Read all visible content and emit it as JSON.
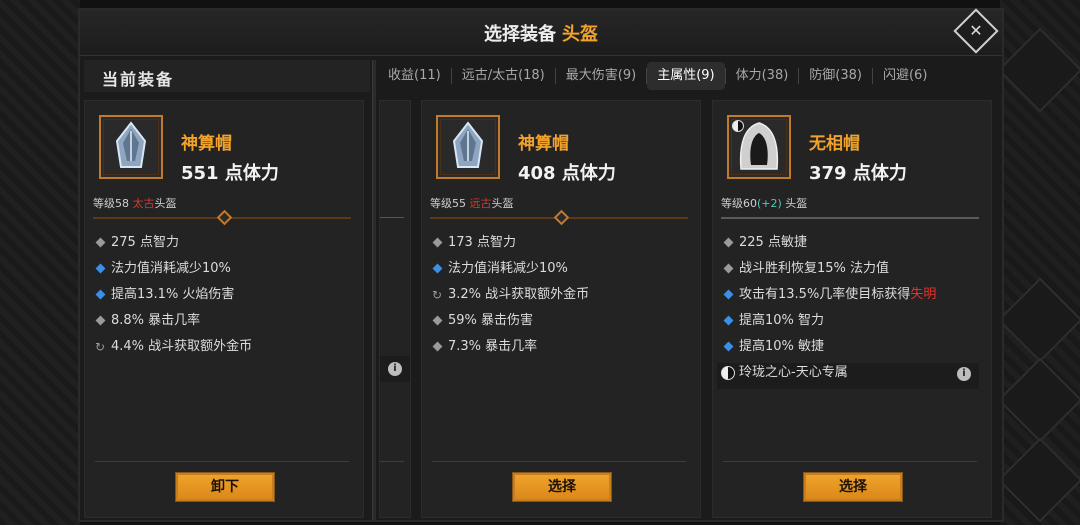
{
  "header": {
    "title_prefix": "选择装备",
    "title_accent": "头盔",
    "close_label": "✕"
  },
  "current_section": {
    "label": "当前装备"
  },
  "tabs": [
    {
      "label": "收益(11)",
      "active": false
    },
    {
      "label": "远古/太古(18)",
      "active": false
    },
    {
      "label": "最大伤害(9)",
      "active": false
    },
    {
      "label": "主属性(9)",
      "active": true
    },
    {
      "label": "体力(38)",
      "active": false
    },
    {
      "label": "防御(38)",
      "active": false
    },
    {
      "label": "闪避(6)",
      "active": false
    }
  ],
  "cards": [
    {
      "name": "神算帽",
      "stat": "551 点体力",
      "level_prefix": "等级58 ",
      "level_tag": "太古",
      "level_suffix": "头盔",
      "attributes": [
        {
          "text": "275 点智力",
          "mark": "gray"
        },
        {
          "text": "法力值消耗减少10%",
          "mark": "blue"
        },
        {
          "text": "提高13.1% 火焰伤害",
          "mark": "blue"
        },
        {
          "text": "8.8% 暴击几率",
          "mark": "gray"
        },
        {
          "text": "4.4% 战斗获取额外金币",
          "mark": "cycle"
        }
      ],
      "button": "卸下"
    },
    {
      "name": "神算帽",
      "stat": "408 点体力",
      "level_prefix": "等级55 ",
      "level_tag": "远古",
      "level_suffix": "头盔",
      "attributes": [
        {
          "text": "173 点智力",
          "mark": "gray"
        },
        {
          "text": "法力值消耗减少10%",
          "mark": "blue"
        },
        {
          "text": "3.2% 战斗获取额外金币",
          "mark": "cycle"
        },
        {
          "text": "59% 暴击伤害",
          "mark": "gray"
        },
        {
          "text": "7.3% 暴击几率",
          "mark": "gray"
        }
      ],
      "button": "选择"
    },
    {
      "name": "无相帽",
      "stat": "379 点体力",
      "level_prefix": "等级60",
      "level_bonus": "(+2)",
      "level_suffix": " 头盔",
      "attributes": [
        {
          "text": "225 点敏捷",
          "mark": "gray"
        },
        {
          "text": "战斗胜利恢复15% 法力值",
          "mark": "gray"
        },
        {
          "text": "攻击有13.5%几率使目标获得",
          "text_red": "失明",
          "mark": "blue"
        },
        {
          "text": "提高10% 智力",
          "mark": "blue"
        },
        {
          "text": "提高10% 敏捷",
          "mark": "blue"
        }
      ],
      "set_bonus": "玲珑之心-天心专属",
      "button": "选择"
    }
  ],
  "colors": {
    "accent": "#f0a22c",
    "tag_red": "#e0342c",
    "bonus_cyan": "#4ccdb8",
    "affix_blue": "#3b8fe6",
    "button": "#f0a52b"
  },
  "icons": [
    "close-icon",
    "helm-crystal-icon",
    "hood-icon",
    "yin-yang-icon",
    "info-icon",
    "cycle-icon"
  ]
}
